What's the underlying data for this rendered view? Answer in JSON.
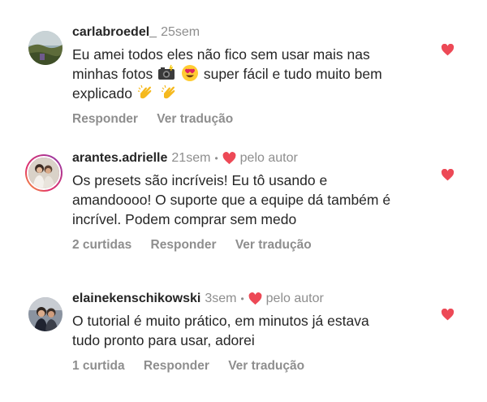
{
  "comments": [
    {
      "username": "carlabroedel_",
      "time": "25sem",
      "liked_by_author": false,
      "lines": [
        "Eu amei todos eles não fico sem usar mais nas",
        "minhas fotos",
        "super fácil e tudo muito bem",
        "explicado"
      ],
      "emoji": [
        "camera-flash-emoji",
        "heart-eyes-emoji",
        "clapping-hands-emoji",
        "clapping-hands-emoji"
      ],
      "likes_label": "",
      "reply_label": "Responder",
      "translate_label": "Ver tradução"
    },
    {
      "username": "arantes.adrielle",
      "time": "21sem",
      "liked_by_author": true,
      "author_label": "pelo autor",
      "lines": [
        "Os presets são incríveis! Eu tô usando e",
        "amandoooo! O suporte que a equipe dá também é",
        "incrível. Podem comprar sem medo"
      ],
      "likes_label": "2 curtidas",
      "reply_label": "Responder",
      "translate_label": "Ver tradução"
    },
    {
      "username": "elainekenschikowski",
      "time": "3sem",
      "liked_by_author": true,
      "author_label": "pelo autor",
      "lines": [
        "O tutorial é muito prático, em minutos já estava",
        "tudo pronto para usar, adorei"
      ],
      "likes_label": "1 curtida",
      "reply_label": "Responder",
      "translate_label": "Ver tradução"
    }
  ],
  "colors": {
    "text": "#262626",
    "muted": "#8e8e8e",
    "heart": "#ed4956"
  },
  "icons": {
    "like": "heart-filled-icon",
    "author_like": "heart-filled-icon"
  }
}
